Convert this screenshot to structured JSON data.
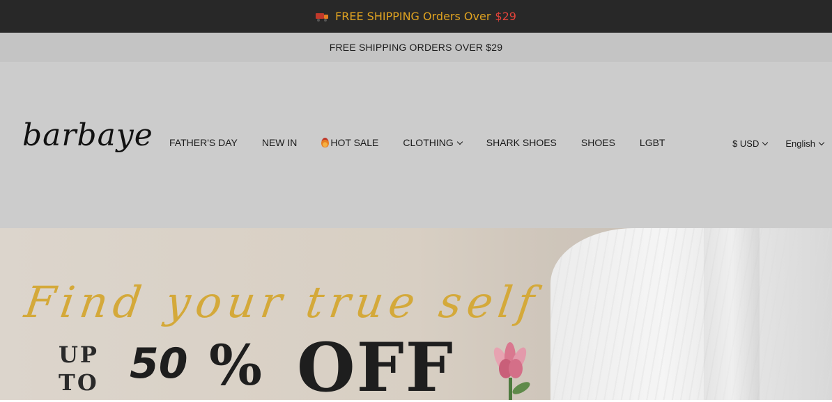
{
  "promo_bar": {
    "text": "FREE SHIPPING Orders Over",
    "price": "$29",
    "icon": "truck-icon",
    "text_color": "#e0a321",
    "price_color": "#e2433a"
  },
  "announcement": {
    "text": "FREE SHIPPING ORDERS OVER $29"
  },
  "header": {
    "logo": "barbaye",
    "nav": [
      {
        "label": "FATHER'S DAY"
      },
      {
        "label": "NEW IN"
      },
      {
        "label": "HOT SALE",
        "icon": "flame-icon"
      },
      {
        "label": "CLOTHING",
        "has_dropdown": true
      },
      {
        "label": "SHARK SHOES"
      },
      {
        "label": "SHOES"
      },
      {
        "label": "LGBT"
      }
    ],
    "currency": "$ USD",
    "language": "English"
  },
  "hero": {
    "script": "Find your true self",
    "up_to_line1": "UP",
    "up_to_line2": "TO",
    "percent_number": "50",
    "percent_sign": "%",
    "off": "OFF"
  }
}
